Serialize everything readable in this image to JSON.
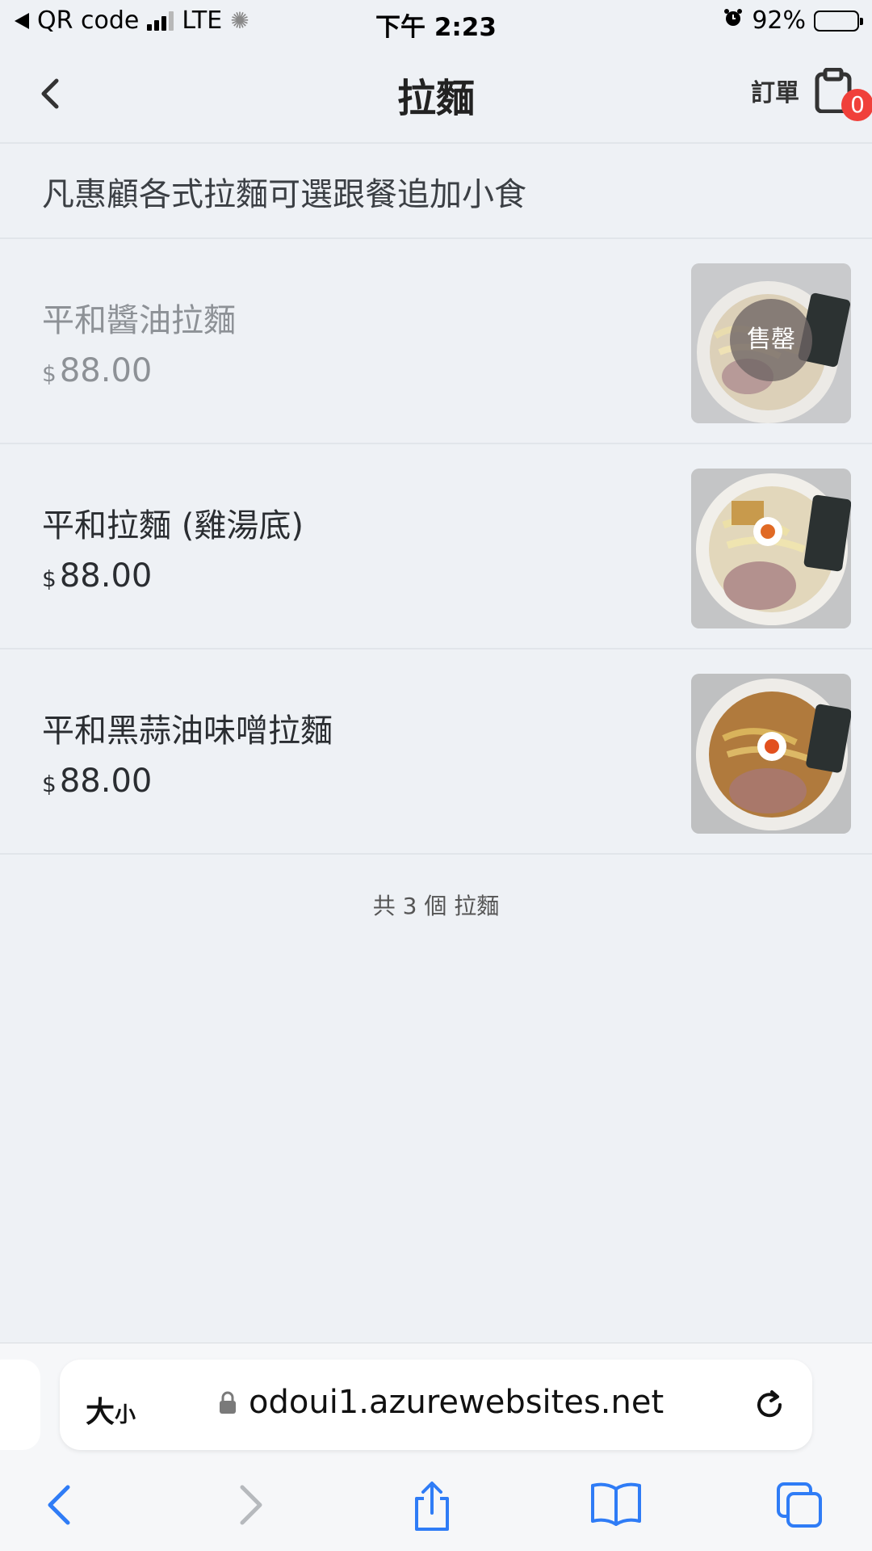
{
  "status_bar": {
    "carrier_back": "QR code",
    "network": "LTE",
    "time": "下午 2:23",
    "battery": "92%"
  },
  "header": {
    "title": "拉麵",
    "orders_label": "訂單",
    "cart_count": "0"
  },
  "description": "凡惠顧各式拉麵可選跟餐追加小食",
  "items": [
    {
      "name": "平和醬油拉麵",
      "currency": "$",
      "price": "88.00",
      "sold_out": true,
      "badge": "售罄"
    },
    {
      "name": "平和拉麵 (雞湯底)",
      "currency": "$",
      "price": "88.00",
      "sold_out": false
    },
    {
      "name": "平和黑蒜油味噌拉麵",
      "currency": "$",
      "price": "88.00",
      "sold_out": false
    }
  ],
  "total_text": "共 3 個 拉麵",
  "browser": {
    "text_size_label_big": "大",
    "text_size_label_small": "小",
    "url": "odoui1.azurewebsites.net"
  },
  "colors": {
    "background": "#eef1f5",
    "badge_red": "#f0403a",
    "safari_blue": "#2f7cf6"
  }
}
